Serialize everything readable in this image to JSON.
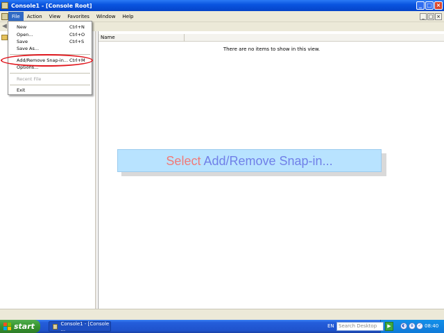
{
  "window": {
    "title": "Console1 - [Console Root]"
  },
  "menubar": {
    "items": [
      {
        "label": "File"
      },
      {
        "label": "Action"
      },
      {
        "label": "View"
      },
      {
        "label": "Favorites"
      },
      {
        "label": "Window"
      },
      {
        "label": "Help"
      }
    ]
  },
  "file_menu": {
    "items": [
      {
        "label": "New",
        "shortcut": "Ctrl+N"
      },
      {
        "label": "Open...",
        "shortcut": "Ctrl+O"
      },
      {
        "label": "Save",
        "shortcut": "Ctrl+S"
      },
      {
        "label": "Save As...",
        "shortcut": ""
      },
      {
        "label": "Add/Remove Snap-in...",
        "shortcut": "Ctrl+M"
      },
      {
        "label": "Options...",
        "shortcut": ""
      },
      {
        "label": "Recent File",
        "shortcut": ""
      },
      {
        "label": "Exit",
        "shortcut": ""
      }
    ]
  },
  "list": {
    "columns": [
      "Name"
    ],
    "empty_message": "There are no items to show in this view."
  },
  "caption": {
    "word1": "Select",
    "rest": "Add/Remove Snap-in..."
  },
  "taskbar": {
    "start_label": "start",
    "task_button": "Console1 - [Console ...",
    "language": "EN",
    "search_placeholder": "Search Desktop",
    "clock": "08:40"
  },
  "colors": {
    "highlight_ring": "#e0161d",
    "caption_bg": "#b8e3ff",
    "caption_word1": "#f07a78",
    "caption_rest": "#7080e8",
    "titlebar_blue": "#0a55e0",
    "start_green": "#37952f"
  }
}
